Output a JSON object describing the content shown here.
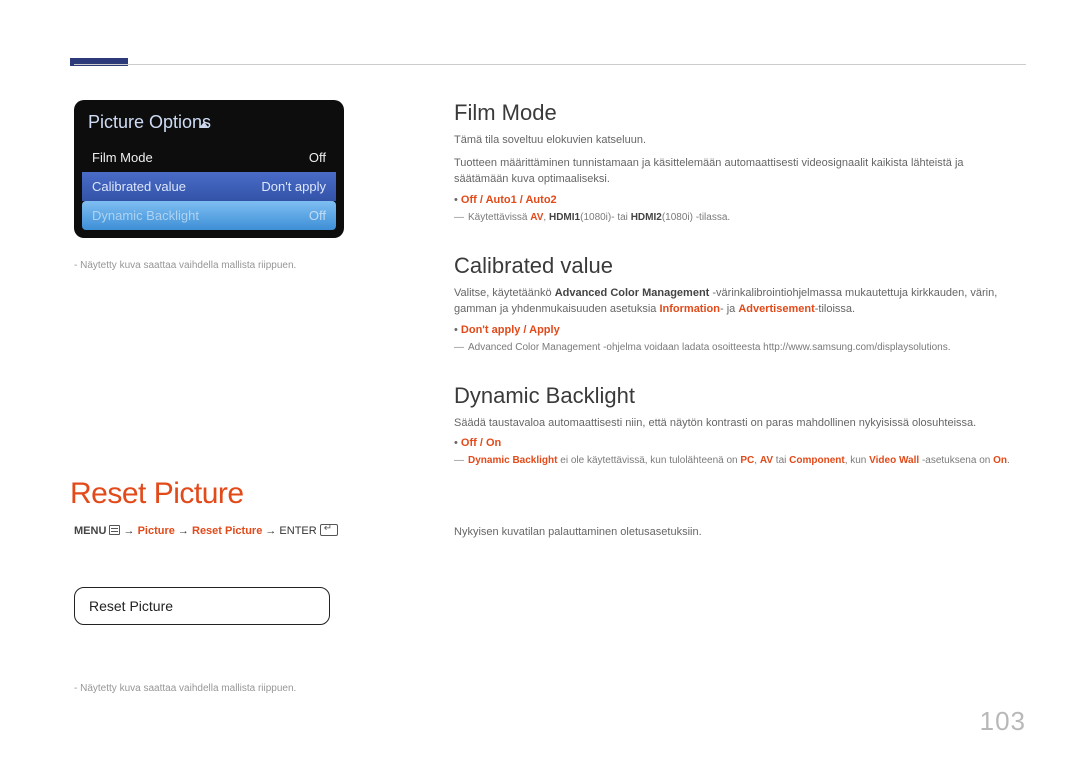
{
  "page_number": "103",
  "menu_panel": {
    "title": "Picture Options",
    "rows": [
      {
        "label": "Film Mode",
        "value": "Off"
      },
      {
        "label": "Calibrated value",
        "value": "Don't apply"
      },
      {
        "label": "Dynamic Backlight",
        "value": "Off"
      }
    ]
  },
  "caption_menu": "- Näytetty kuva saattaa vaihdella mallista riippuen.",
  "sections": {
    "film_mode": {
      "title": "Film Mode",
      "p1": "Tämä tila soveltuu elokuvien katseluun.",
      "p2_pre": "Tuotteen määrittäminen tunnistamaan ja käsittelemään automaattisesti videosignaalit kaikista lähteistä ja säätämään kuva optimaaliseksi.",
      "bullet": "Off / Auto1 / Auto2",
      "note_pre": "Käytettävissä ",
      "note_av": "AV",
      "note_sep1": ", ",
      "note_h1": "HDMI1",
      "note_mid": "(1080i)- tai ",
      "note_h2": "HDMI2",
      "note_end": "(1080i) -tilassa."
    },
    "calibrated": {
      "title": "Calibrated value",
      "p1_pre": "Valitse, käytetäänkö ",
      "p1_b1": "Advanced Color Management",
      "p1_mid": " -värinkalibrointiohjelmassa mukautettuja kirkkauden, värin, gamman ja yhdenmukaisuuden asetuksia ",
      "p1_r1": "Information",
      "p1_and": "- ja ",
      "p1_r2": "Advertisement",
      "p1_end": "-tiloissa.",
      "bullet": "Don't apply / Apply",
      "note": "Advanced Color Management -ohjelma voidaan ladata osoitteesta http://www.samsung.com/displaysolutions."
    },
    "backlight": {
      "title": "Dynamic Backlight",
      "p1": "Säädä taustavaloa automaattisesti niin, että näytön kontrasti on paras mahdollinen nykyisissä olosuhteissa.",
      "bullet": "Off / On",
      "note_pre": "",
      "note_db": "Dynamic Backlight",
      "note_mid1": " ei ole käytettävissä, kun tulolähteenä on ",
      "note_pc": "PC",
      "note_c1": ", ",
      "note_av": "AV",
      "note_mid2": " tai ",
      "note_comp": "Component",
      "note_mid3": ", kun ",
      "note_vw": "Video Wall",
      "note_mid4": " -asetuksena on ",
      "note_on": "On",
      "note_end": "."
    }
  },
  "reset": {
    "heading": "Reset Picture",
    "nav_menu": "MENU",
    "nav_arrow": " → ",
    "nav_p1": "Picture",
    "nav_p2": "Reset Picture",
    "nav_enter": " → ENTER ",
    "box_label": "Reset Picture",
    "description": "Nykyisen kuvatilan palauttaminen oletusasetuksiin."
  },
  "caption_reset": "- Näytetty kuva saattaa vaihdella mallista riippuen."
}
